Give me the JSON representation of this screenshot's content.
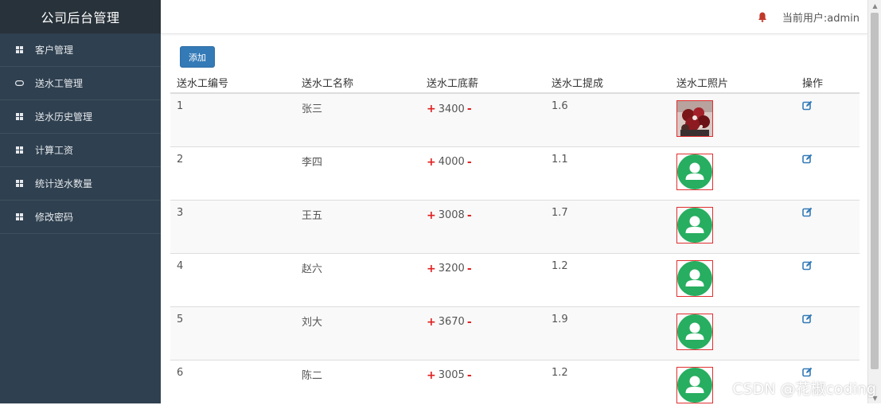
{
  "app": {
    "title": "公司后台管理"
  },
  "sidebar": {
    "items": [
      {
        "label": "客户管理",
        "icon": "grid-icon"
      },
      {
        "label": "送水工管理",
        "icon": "link-icon"
      },
      {
        "label": "送水历史管理",
        "icon": "grid-icon"
      },
      {
        "label": "计算工资",
        "icon": "grid-icon"
      },
      {
        "label": "统计送水数量",
        "icon": "grid-icon"
      },
      {
        "label": "修改密码",
        "icon": "grid-icon"
      }
    ]
  },
  "header": {
    "current_user": "当前用户:admin",
    "bell_color": "#c0392b"
  },
  "toolbar": {
    "add_label": "添加"
  },
  "table": {
    "columns": [
      "送水工编号",
      "送水工名称",
      "送水工底薪",
      "送水工提成",
      "送水工照片",
      "操作"
    ],
    "rows": [
      {
        "id": "1",
        "name": "张三",
        "salary": "3400",
        "commission": "1.6",
        "photo": "custom-photo"
      },
      {
        "id": "2",
        "name": "李四",
        "salary": "4000",
        "commission": "1.1",
        "photo": "default-avatar-icon"
      },
      {
        "id": "3",
        "name": "王五",
        "salary": "3008",
        "commission": "1.7",
        "photo": "default-avatar-icon"
      },
      {
        "id": "4",
        "name": "赵六",
        "salary": "3200",
        "commission": "1.2",
        "photo": "default-avatar-icon"
      },
      {
        "id": "5",
        "name": "刘大",
        "salary": "3670",
        "commission": "1.9",
        "photo": "default-avatar-icon"
      },
      {
        "id": "6",
        "name": "陈二",
        "salary": "3005",
        "commission": "1.2",
        "photo": "default-avatar-icon"
      }
    ],
    "plus_symbol": "+",
    "minus_symbol": "-"
  },
  "colors": {
    "sidebar_bg": "#2f4050",
    "brand_bg": "#28323a",
    "primary": "#337ab7",
    "accent_red": "#e02020",
    "avatar_green": "#27ae60"
  },
  "watermark": "CSDN @花椒coding"
}
